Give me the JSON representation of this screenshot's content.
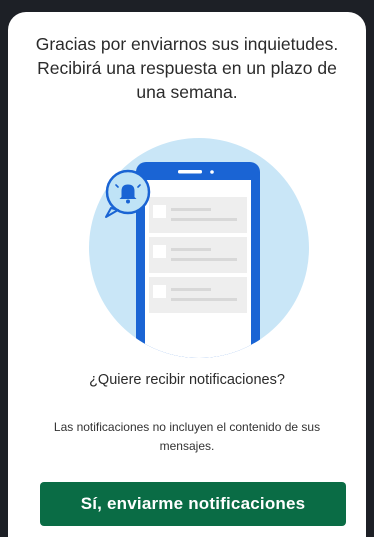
{
  "dialog": {
    "message": "Gracias por enviarnos sus inquietudes. Recibirá una respuesta en un plazo de una semana.",
    "illustration_icon": "phone-notification-bell",
    "question": "¿Quiere recibir notificaciones?",
    "note": "Las notificaciones no incluyen el contenido de sus mensajes.",
    "confirm_button": "Sí, enviarme notificaciones"
  },
  "colors": {
    "background_dark": "#1d2026",
    "circle": "#c9e6f7",
    "phone_blue": "#1a64d4",
    "bell_bubble": "#bfe3f6",
    "button_green": "#0a6c45"
  }
}
